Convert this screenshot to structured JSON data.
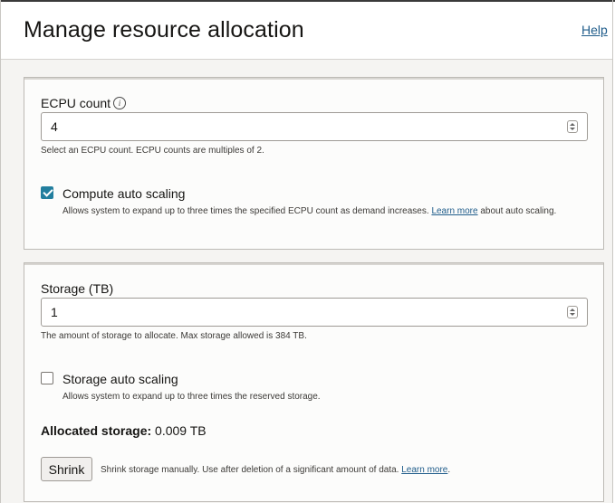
{
  "header": {
    "title": "Manage resource allocation",
    "help_link": "Help"
  },
  "ecpu": {
    "label": "ECPU count",
    "info_icon": "info-icon",
    "value": "4",
    "help": "Select an ECPU count. ECPU counts are multiples of 2.",
    "auto_scaling": {
      "checked": true,
      "label": "Compute auto scaling",
      "help_prefix": "Allows system to expand up to three times the specified ECPU count as demand increases.",
      "learn_more": "Learn more",
      "help_suffix": "about auto scaling."
    }
  },
  "storage": {
    "label": "Storage (TB)",
    "value": "1",
    "help": "The amount of storage to allocate. Max storage allowed is 384 TB.",
    "auto_scaling": {
      "checked": false,
      "label": "Storage auto scaling",
      "help": "Allows system to expand up to three times the reserved storage."
    },
    "allocated_label": "Allocated storage:",
    "allocated_value": "0.009 TB",
    "shrink_button": "Shrink",
    "shrink_help": "Shrink storage manually. Use after deletion of a significant amount of data.",
    "shrink_learn_more": "Learn more",
    "shrink_learn_more_suffix": "."
  },
  "colors": {
    "accent": "#227e9e",
    "link": "#1f5c8a",
    "panel_background": "#f5f4f2"
  }
}
